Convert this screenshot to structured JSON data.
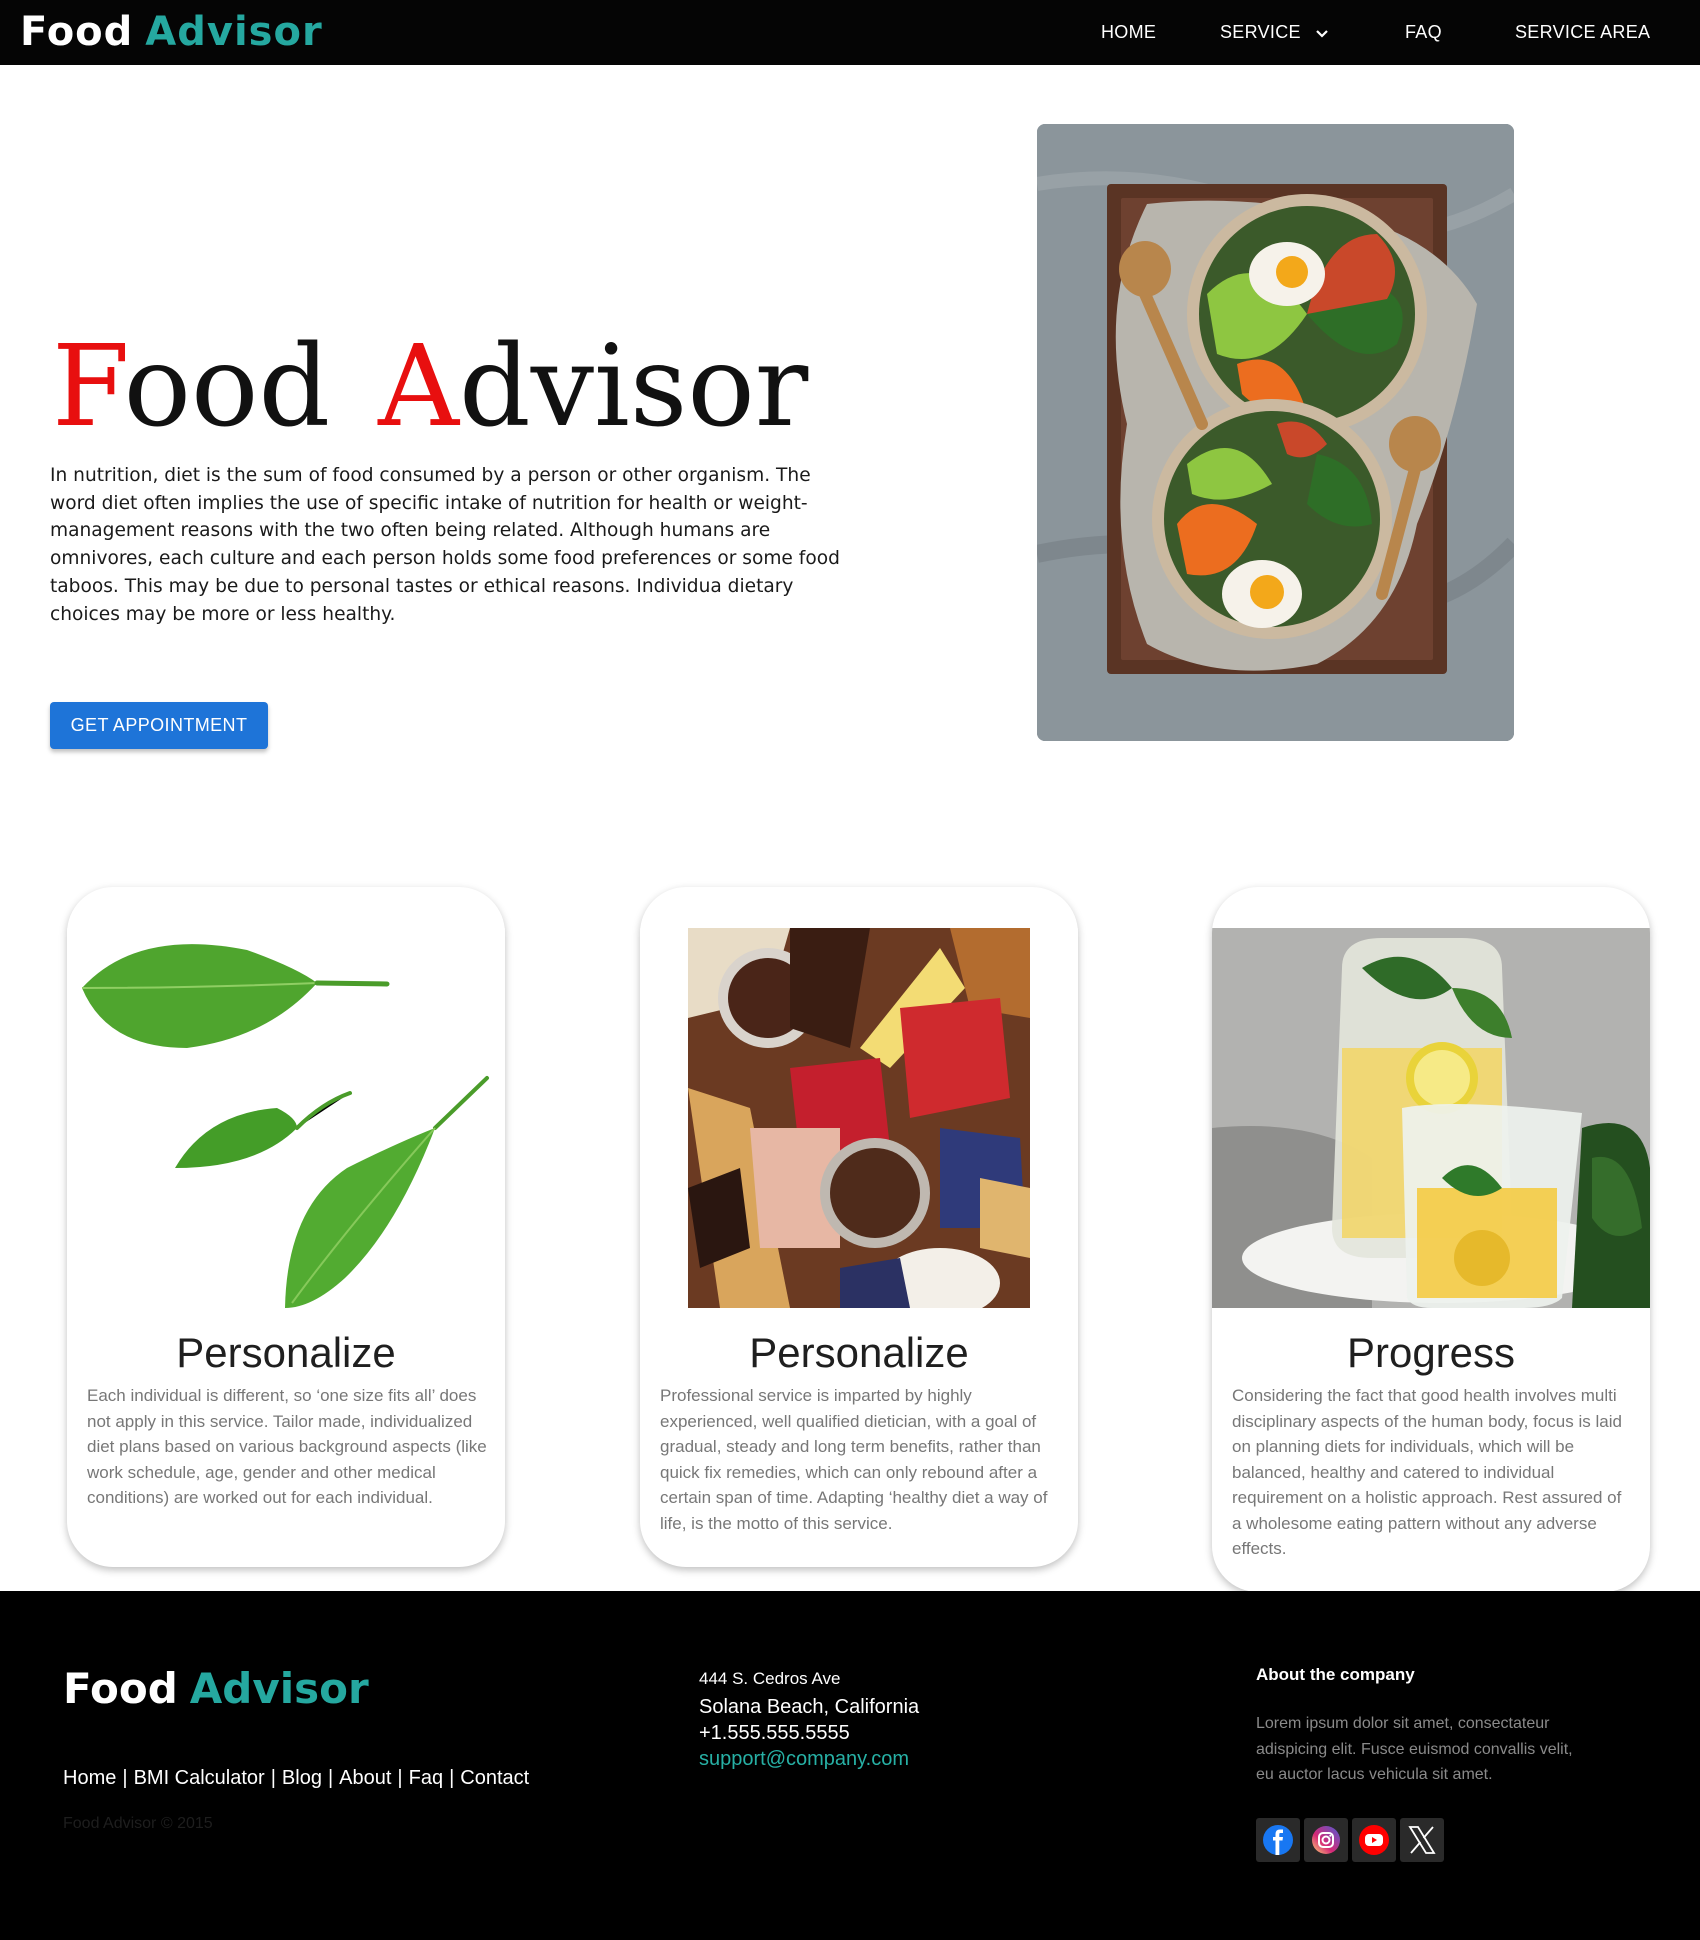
{
  "nav": {
    "logo_word1": "Food",
    "logo_word2": "Advisor",
    "items": [
      {
        "label": "HOME"
      },
      {
        "label": "SERVICE"
      },
      {
        "label": "FAQ"
      },
      {
        "label": "SERVICE AREA"
      }
    ]
  },
  "hero": {
    "title_f": "F",
    "title_ood": "ood",
    "title_a": "A",
    "title_dvisor": "dvisor",
    "body": "In nutrition, diet is the sum of food consumed by a person or other organism. The word diet often implies the use of specific intake of nutrition for health or weight-management reasons with the two often being related. Although humans are omnivores, each culture and each person holds some food preferences or some food taboos. This may be due to personal tastes or ethical reasons. Individua dietary choices may be more or less healthy.",
    "button_label": "GET APPOINTMENT",
    "image_icon": "bibimbap-bowls-photo"
  },
  "cards": [
    {
      "title": "Personalize",
      "text": "Each individual is different, so ‘one size fits all’ does not apply in this service. Tailor made, individualized diet plans based on various background aspects (like work schedule, age, gender and other medical conditions) are worked out for each individual.",
      "image_icon": "green-leaves-photo"
    },
    {
      "title": "Personalize",
      "text": "Professional service is imparted by highly experienced, well qualified dietician, with a goal of gradual, steady and long term benefits, rather than quick fix remedies, which can only rebound after a certain span of time. Adapting ‘healthy diet a way of life, is the motto of this service.",
      "image_icon": "snack-board-photo"
    },
    {
      "title": "Progress",
      "text": "Considering the fact that good health involves multi disciplinary aspects of the human body, focus is laid on planning diets for individuals, which will be balanced, healthy and catered to individual requirement on a holistic approach. Rest assured of a wholesome eating pattern without any adverse effects.",
      "image_icon": "lemonade-drinks-photo"
    }
  ],
  "footer": {
    "logo_word1": "Food",
    "logo_word2": "Advisor",
    "links": [
      "Home",
      "BMI Calculator",
      "Blog",
      "About",
      "Faq",
      "Contact"
    ],
    "copyright": "Food Advisor © 2015",
    "address_line1": "444 S. Cedros Ave",
    "address_line2": "Solana Beach, California",
    "phone": "+1.555.555.5555",
    "email": "support@company.com",
    "about_heading": "About the company",
    "about_text": "Lorem ipsum dolor sit amet, consectateur adispicing elit. Fusce euismod convallis velit, eu auctor lacus vehicula sit amet.",
    "social_icons": [
      "facebook-icon",
      "instagram-icon",
      "youtube-icon",
      "x-icon"
    ]
  },
  "colors": {
    "brand_teal": "#25a8a0",
    "accent_red": "#e80f0f",
    "button_blue": "#1e74d8",
    "nav_bg": "#050505"
  }
}
